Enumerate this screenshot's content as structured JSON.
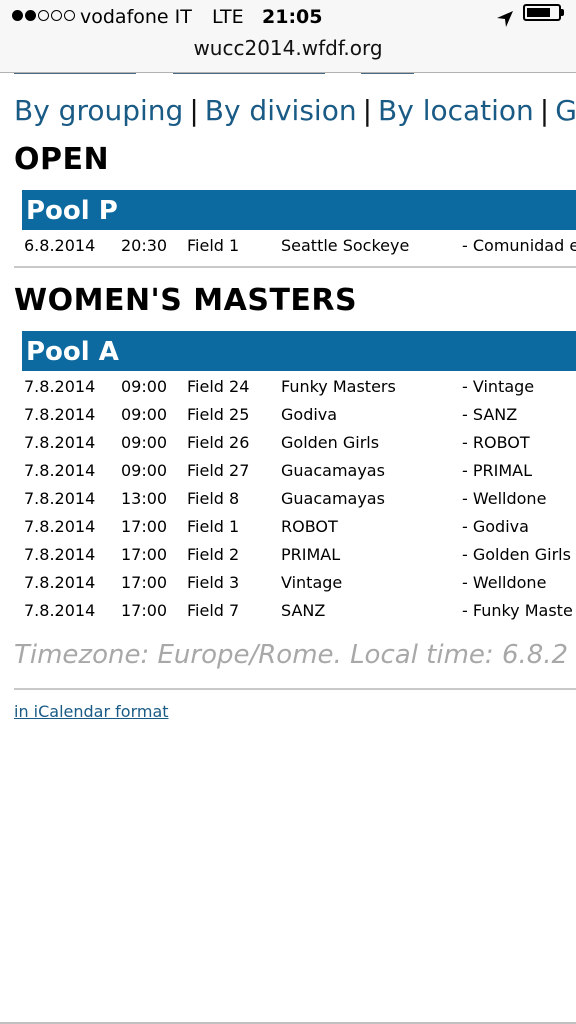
{
  "status_bar": {
    "signal_full": 2,
    "signal_total": 5,
    "carrier": "vodafone IT",
    "network": "LTE",
    "time": "21:05",
    "battery_level": 0.75
  },
  "url": "wucc2014.wfdf.org",
  "nav": {
    "by_grouping": "By grouping",
    "by_division": "By division",
    "by_location": "By location",
    "truncated": "G"
  },
  "sections": [
    {
      "division": "OPEN",
      "pool": "Pool P",
      "games": [
        {
          "date": "6.8.2014",
          "time": "20:30",
          "field": "Field 1",
          "home": "Seattle Sockeye",
          "away": "- Comunidad e"
        }
      ]
    },
    {
      "division": "WOMEN'S MASTERS",
      "pool": "Pool A",
      "games": [
        {
          "date": "7.8.2014",
          "time": "09:00",
          "field": "Field 24",
          "home": "Funky Masters",
          "away": "- Vintage"
        },
        {
          "date": "7.8.2014",
          "time": "09:00",
          "field": "Field 25",
          "home": "Godiva",
          "away": "- SANZ"
        },
        {
          "date": "7.8.2014",
          "time": "09:00",
          "field": "Field 26",
          "home": "Golden Girls",
          "away": "- ROBOT"
        },
        {
          "date": "7.8.2014",
          "time": "09:00",
          "field": "Field 27",
          "home": "Guacamayas",
          "away": "- PRIMAL"
        },
        {
          "date": "7.8.2014",
          "time": "13:00",
          "field": "Field 8",
          "home": "Guacamayas",
          "away": "- Welldone"
        },
        {
          "date": "7.8.2014",
          "time": "17:00",
          "field": "Field 1",
          "home": "ROBOT",
          "away": "- Godiva"
        },
        {
          "date": "7.8.2014",
          "time": "17:00",
          "field": "Field 2",
          "home": "PRIMAL",
          "away": "- Golden Girls"
        },
        {
          "date": "7.8.2014",
          "time": "17:00",
          "field": "Field 3",
          "home": "Vintage",
          "away": "- Welldone"
        },
        {
          "date": "7.8.2014",
          "time": "17:00",
          "field": "Field 7",
          "home": "SANZ",
          "away": "- Funky Maste"
        }
      ]
    }
  ],
  "timezone_text": "Timezone: Europe/Rome. Local time: 6.8.2",
  "ical_link": "in iCalendar format",
  "colors": {
    "pool_bar": "#0c6aa0",
    "link": "#1a5b86",
    "timezone": "#a8a8a8"
  }
}
